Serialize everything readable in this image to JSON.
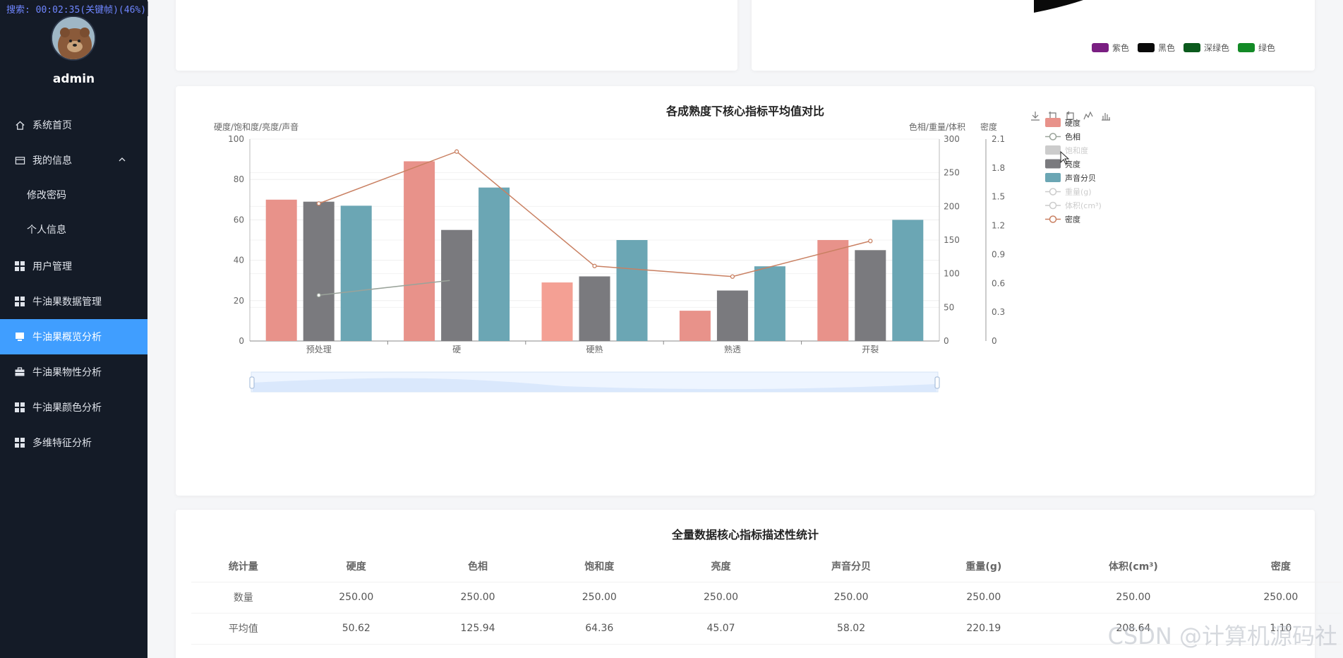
{
  "overlay": "搜索: 00:02:35(关键帧)(46%)",
  "sidebar": {
    "username": "admin",
    "items": [
      {
        "label": "系统首页",
        "icon": "home-icon"
      },
      {
        "label": "我的信息",
        "icon": "card-icon"
      },
      {
        "label": "修改密码"
      },
      {
        "label": "个人信息"
      },
      {
        "label": "用户管理",
        "icon": "grid-icon"
      },
      {
        "label": "牛油果数据管理",
        "icon": "grid-icon"
      },
      {
        "label": "牛油果概览分析",
        "icon": "monitor-icon"
      },
      {
        "label": "牛油果物性分析",
        "icon": "briefcase-icon"
      },
      {
        "label": "牛油果颜色分析",
        "icon": "grid-icon"
      },
      {
        "label": "多维特征分析",
        "icon": "grid-icon"
      }
    ]
  },
  "top_legend": [
    {
      "label": "紫色",
      "color": "#7a1f82"
    },
    {
      "label": "黑色",
      "color": "#0a0a0a"
    },
    {
      "label": "深绿色",
      "color": "#0b5a1d"
    },
    {
      "label": "绿色",
      "color": "#138a26"
    }
  ],
  "chart_data": {
    "type": "bar",
    "title": "各成熟度下核心指标平均值对比",
    "categories": [
      "预处理",
      "硬",
      "硬熟",
      "熟透",
      "开裂"
    ],
    "left_axis": {
      "label": "硬度/饱和度/亮度/声音",
      "ticks": [
        "0",
        "20",
        "40",
        "60",
        "80",
        "100"
      ],
      "ylim": [
        0,
        100
      ]
    },
    "right_axis_1": {
      "label": "色相/重量/体积",
      "ticks": [
        "0",
        "50",
        "100",
        "150",
        "200",
        "250",
        "300"
      ],
      "ylim": [
        0,
        300
      ]
    },
    "right_axis_2": {
      "label": "密度",
      "ticks": [
        "0",
        "0.3",
        "0.6",
        "0.9",
        "1.2",
        "1.5",
        "1.8",
        "2.1"
      ],
      "ylim": [
        0,
        2.1
      ]
    },
    "series": [
      {
        "name": "硬度",
        "kind": "bar",
        "color": "#e8928a",
        "values": [
          70,
          89,
          29,
          15,
          50
        ]
      },
      {
        "name": "色相",
        "kind": "line",
        "color": "#9aa39a",
        "values": [
          68,
          90,
          null,
          null,
          null
        ]
      },
      {
        "name": "饱和度",
        "kind": "bar",
        "hidden": true,
        "color": "#cccccc",
        "values": []
      },
      {
        "name": "亮度",
        "kind": "bar",
        "color": "#7a7a7e",
        "values": [
          69,
          55,
          32,
          25,
          45
        ]
      },
      {
        "name": "声音分贝",
        "kind": "bar",
        "color": "#6ba6b4",
        "values": [
          67,
          76,
          50,
          37,
          60
        ]
      },
      {
        "name": "重量(g)",
        "kind": "line",
        "hidden": true,
        "values": []
      },
      {
        "name": "体积(cm³)",
        "kind": "line",
        "hidden": true,
        "values": []
      },
      {
        "name": "密度",
        "kind": "line",
        "color": "#c98062",
        "values": [
          1.43,
          1.97,
          0.78,
          0.67,
          1.04
        ]
      }
    ]
  },
  "table": {
    "title": "全量数据核心指标描述性统计",
    "headers": [
      "统计量",
      "硬度",
      "色相",
      "饱和度",
      "亮度",
      "声音分贝",
      "重量(g)",
      "体积(cm³)",
      "密度"
    ],
    "rows": [
      [
        "数量",
        "250.00",
        "250.00",
        "250.00",
        "250.00",
        "250.00",
        "250.00",
        "250.00",
        "250.00"
      ],
      [
        "平均值",
        "50.62",
        "125.94",
        "64.36",
        "45.07",
        "58.02",
        "220.19",
        "208.64",
        "1.10"
      ]
    ]
  },
  "watermark": "CSDN @计算机源码社"
}
